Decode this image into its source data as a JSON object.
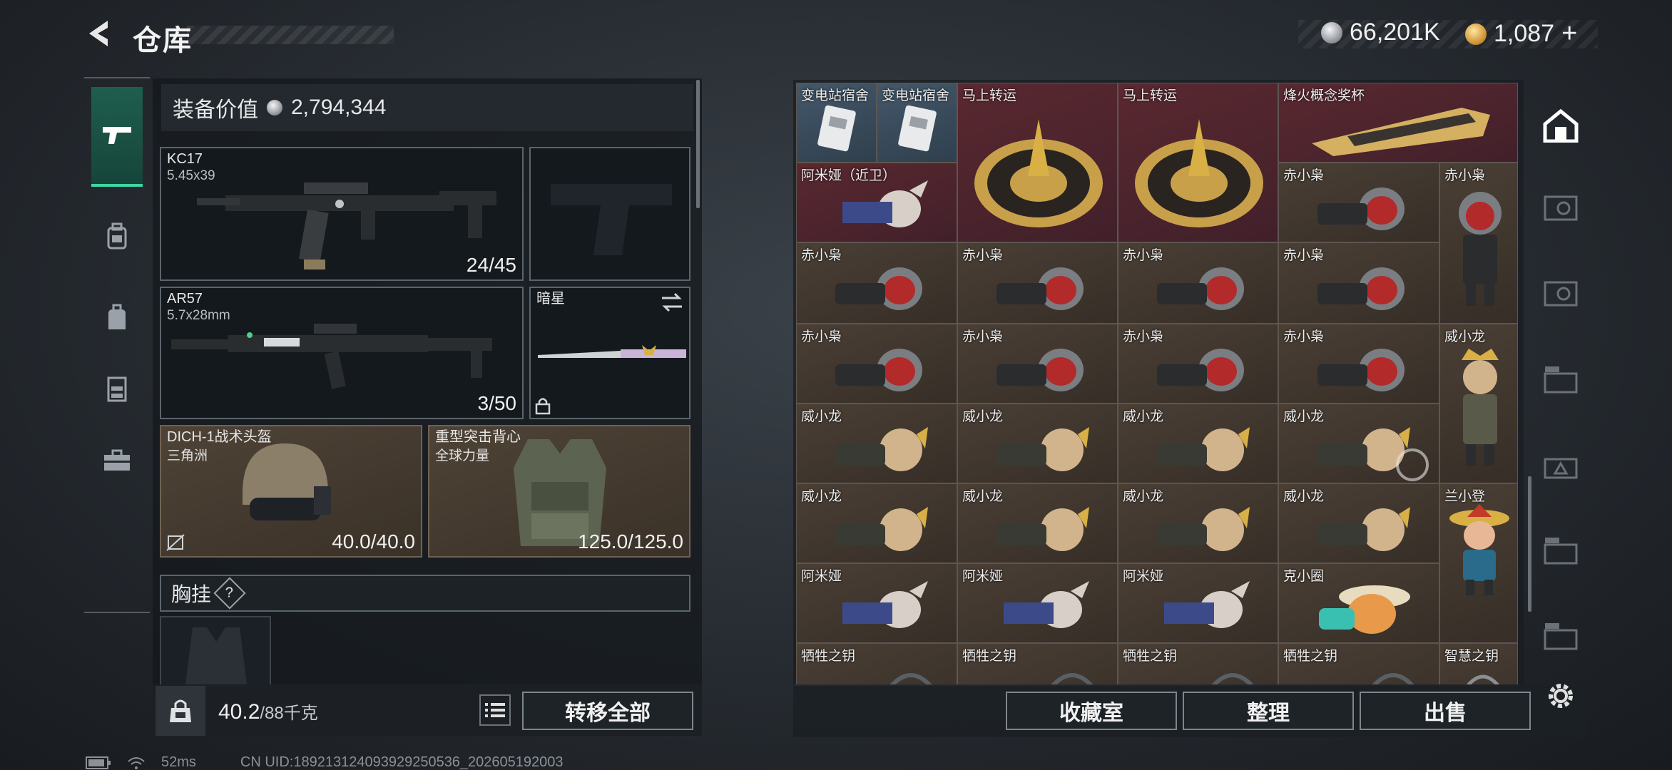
{
  "header": {
    "title": "仓库",
    "currencies": [
      {
        "icon": "silver-coin-icon",
        "value": "66,201K"
      },
      {
        "icon": "gold-coin-icon",
        "value": "1,087"
      }
    ],
    "add_symbol": "+"
  },
  "left_nav": [
    "gun-icon",
    "backpack-icon",
    "bag-icon",
    "vest-icon",
    "toolbox-icon"
  ],
  "equipment": {
    "value_label": "装备价值",
    "value": "2,794,344",
    "primary": {
      "name": "KC17",
      "caliber": "5.45x39",
      "ammo": "24/45"
    },
    "secondary": {
      "name": "AR57",
      "caliber": "5.7x28mm",
      "ammo": "3/50"
    },
    "melee": {
      "name": "暗星"
    },
    "helmet": {
      "name": "DICH-1战术头盔",
      "sub": "三角洲",
      "durability": "40.0/40.0"
    },
    "armor": {
      "name": "重型突击背心",
      "sub": "全球力量",
      "durability": "125.0/125.0"
    },
    "chest_label": "胸挂",
    "chest_help": "?"
  },
  "capacity": {
    "current": "40.2",
    "max": "/88千克"
  },
  "buttons": {
    "transfer_all": "转移全部",
    "collection": "收藏室",
    "organize": "整理",
    "sell": "出售"
  },
  "stash": {
    "row0": [
      "变电站宿舍",
      "变电站宿舍",
      "马上转运",
      "马上转运",
      "烽火概念奖杯"
    ],
    "row1": [
      "阿米娅（近卫）",
      "赤小枭",
      "赤小枭"
    ],
    "row2": [
      "赤小枭",
      "赤小枭",
      "赤小枭",
      "赤小枭"
    ],
    "row3": [
      "赤小枭",
      "赤小枭",
      "赤小枭",
      "赤小枭",
      "威小龙"
    ],
    "row4": [
      "威小龙",
      "威小龙",
      "威小龙",
      "威小龙"
    ],
    "row5": [
      "威小龙",
      "威小龙",
      "威小龙",
      "威小龙",
      "兰小登"
    ],
    "row6": [
      "阿米娅",
      "阿米娅",
      "阿米娅",
      "克小圈"
    ],
    "row7": [
      "牺牲之钥",
      "牺牲之钥",
      "牺牲之钥",
      "牺牲之钥",
      "智慧之钥"
    ]
  },
  "right_nav": [
    "stash-home-icon",
    "vault-tab-1-icon",
    "vault-tab-2-icon",
    "gti-tab-1-icon",
    "gti-tab-2-icon",
    "gti-tab-3-icon",
    "gti-tab-4-icon"
  ],
  "status": {
    "ping": "52ms",
    "uid": "CN UID:1892131240939292505​36_202605192003"
  }
}
